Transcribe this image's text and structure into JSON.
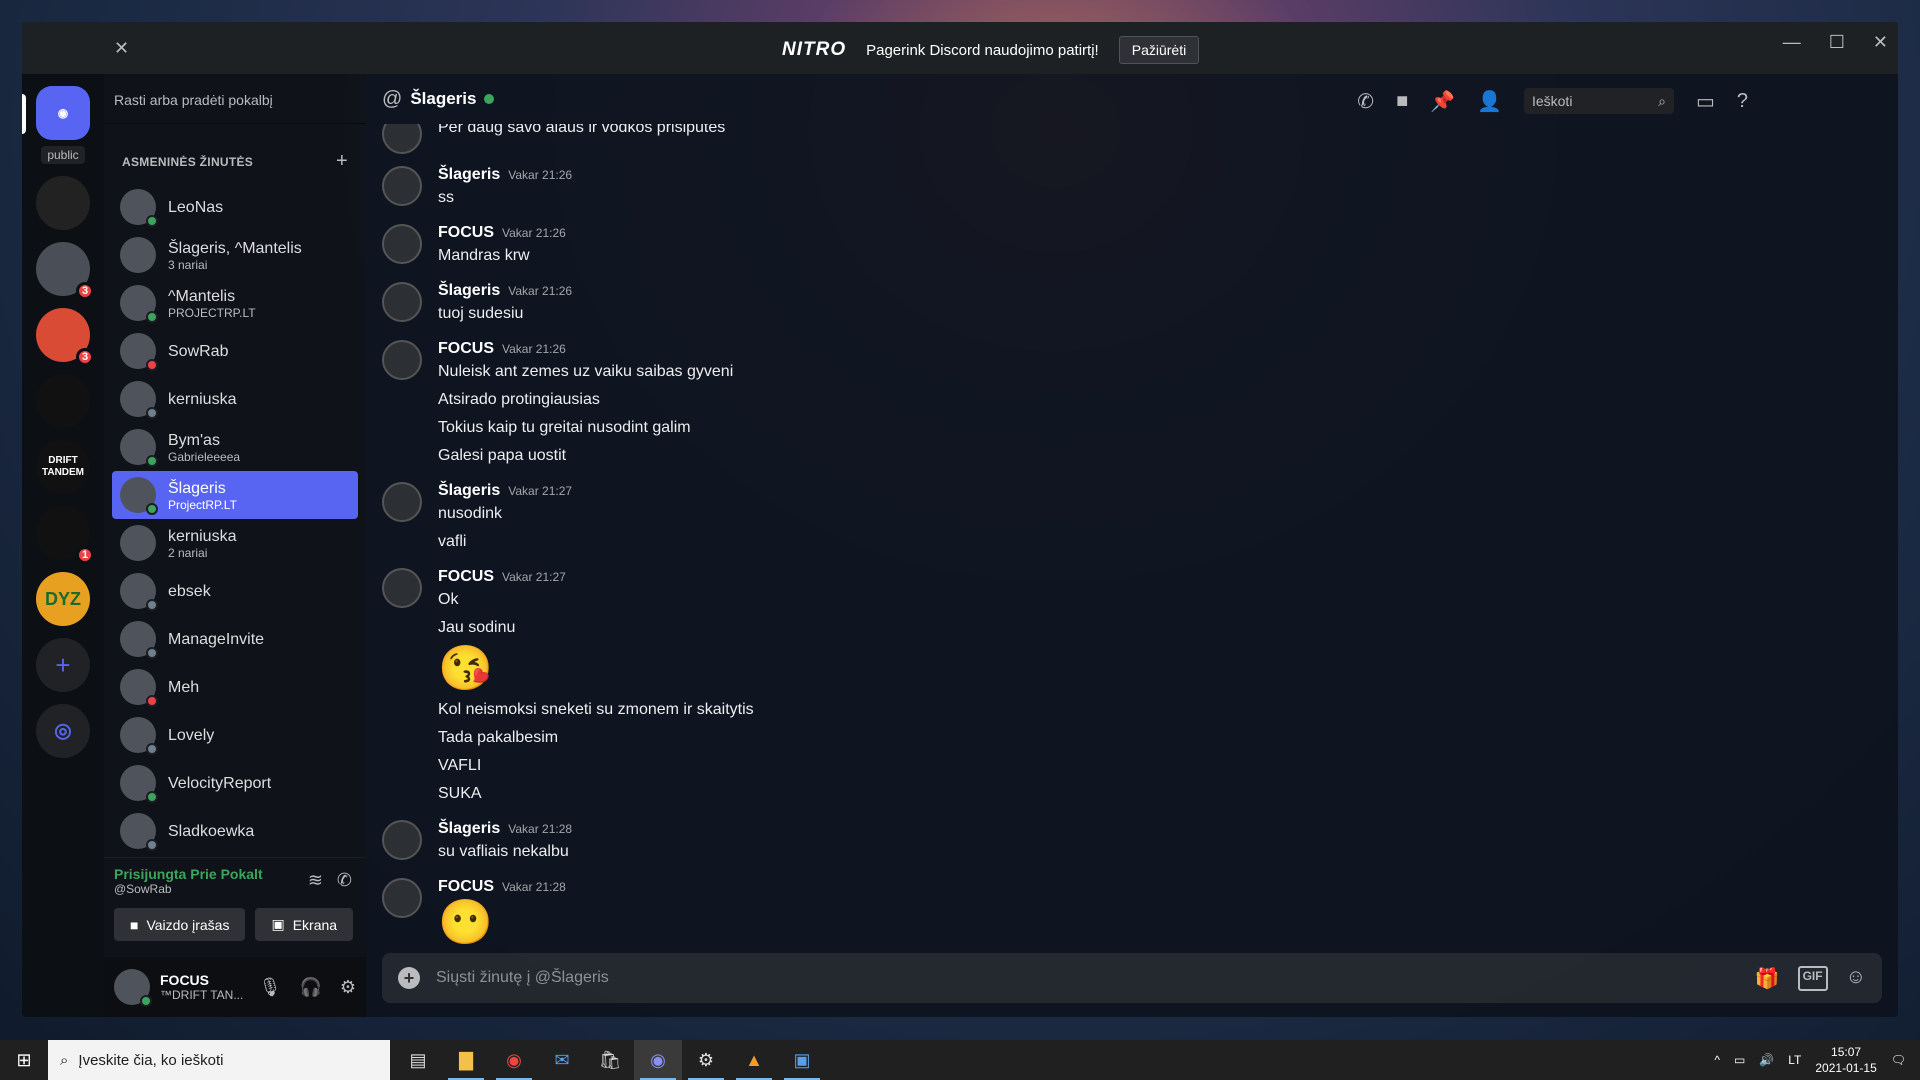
{
  "titlebar": {
    "nitro_logo": "NITRO",
    "nitro_text": "Pagerink Discord naudojimo patirtį!",
    "nitro_button": "Pažiūrėti"
  },
  "servers": {
    "public_label": "public",
    "items": [
      {
        "label": "",
        "badge": ""
      },
      {
        "label": "",
        "badge": "3"
      },
      {
        "label": "",
        "badge": "3"
      },
      {
        "label": "",
        "badge": ""
      },
      {
        "label": "DRIFT TANDEM",
        "badge": ""
      },
      {
        "label": "",
        "badge": "1"
      },
      {
        "label": "DYZ",
        "badge": ""
      }
    ]
  },
  "dm_panel": {
    "search_placeholder": "Rasti arba pradėti pokalbį",
    "section_title": "ASMENINĖS ŽINUTĖS",
    "items": [
      {
        "name": "LeoNas",
        "sub": "",
        "status": "#3ba55d"
      },
      {
        "name": "Šlageris, ^Mantelis",
        "sub": "3 nariai",
        "status": ""
      },
      {
        "name": "^Mantelis",
        "sub": "PROJECTRP.LT",
        "status": "#3ba55d"
      },
      {
        "name": "SowRab",
        "sub": "",
        "status": "#ed4245"
      },
      {
        "name": "kerniuska",
        "sub": "",
        "status": "#747f8d"
      },
      {
        "name": "Bym'as",
        "sub": "Gabrieleeeea",
        "status": "#3ba55d"
      },
      {
        "name": "Šlageris",
        "sub": "ProjectRP.LT",
        "status": "#3ba55d"
      },
      {
        "name": "kerniuska",
        "sub": "2 nariai",
        "status": ""
      },
      {
        "name": "ebsek",
        "sub": "",
        "status": "#747f8d"
      },
      {
        "name": "ManageInvite",
        "sub": "",
        "status": "#747f8d"
      },
      {
        "name": "Meh",
        "sub": "",
        "status": "#ed4245"
      },
      {
        "name": "Lovely",
        "sub": "",
        "status": "#747f8d"
      },
      {
        "name": "VelocityReport",
        "sub": "",
        "status": "#3ba55d"
      },
      {
        "name": "Sladkoewka",
        "sub": "",
        "status": "#747f8d"
      }
    ],
    "voice_title": "Prisijungta Prie Pokalt",
    "voice_sub": "@SowRab",
    "video_button": "Vaizdo įrašas",
    "screen_button": "Ekrana",
    "user_name": "FOCUS",
    "user_sub": "™DRIFT TAN..."
  },
  "chat": {
    "channel_name": "Šlageris",
    "search_placeholder": "Ieškoti",
    "input_placeholder": "Siųsti žinutę į @Šlageris",
    "gif_label": "GIF",
    "messages": [
      {
        "author": "",
        "time": "",
        "lines": [
          "Per daug savo alaus ir vodkos prisiputes"
        ]
      },
      {
        "author": "Šlageris",
        "time": "Vakar 21:26",
        "lines": [
          "ss"
        ]
      },
      {
        "author": "FOCUS",
        "time": "Vakar 21:26",
        "lines": [
          "Mandras krw"
        ]
      },
      {
        "author": "Šlageris",
        "time": "Vakar 21:26",
        "lines": [
          "tuoj sudesiu"
        ]
      },
      {
        "author": "FOCUS",
        "time": "Vakar 21:26",
        "lines": [
          "Nuleisk ant zemes uz vaiku saibas gyveni",
          "Atsirado protingiausias",
          "Tokius kaip tu greitai nusodint galim",
          "Galesi papa uostit"
        ]
      },
      {
        "author": "Šlageris",
        "time": "Vakar 21:27",
        "lines": [
          "nusodink",
          "vafli"
        ]
      },
      {
        "author": "FOCUS",
        "time": "Vakar 21:27",
        "lines": [
          "Ok",
          "Jau sodinu",
          "😘",
          "Kol neismoksi sneketi su zmonem ir skaitytis",
          "Tada pakalbesim",
          "VAFLI",
          "SUKA"
        ]
      },
      {
        "author": "Šlageris",
        "time": "Vakar 21:28",
        "lines": [
          "su vafliais nekalbu"
        ]
      },
      {
        "author": "FOCUS",
        "time": "Vakar 21:28",
        "lines": [
          "😶"
        ]
      }
    ]
  },
  "taskbar": {
    "search_placeholder": "Įveskite čia, ko ieškoti",
    "lang": "LT",
    "time": "15:07",
    "date": "2021-01-15"
  }
}
